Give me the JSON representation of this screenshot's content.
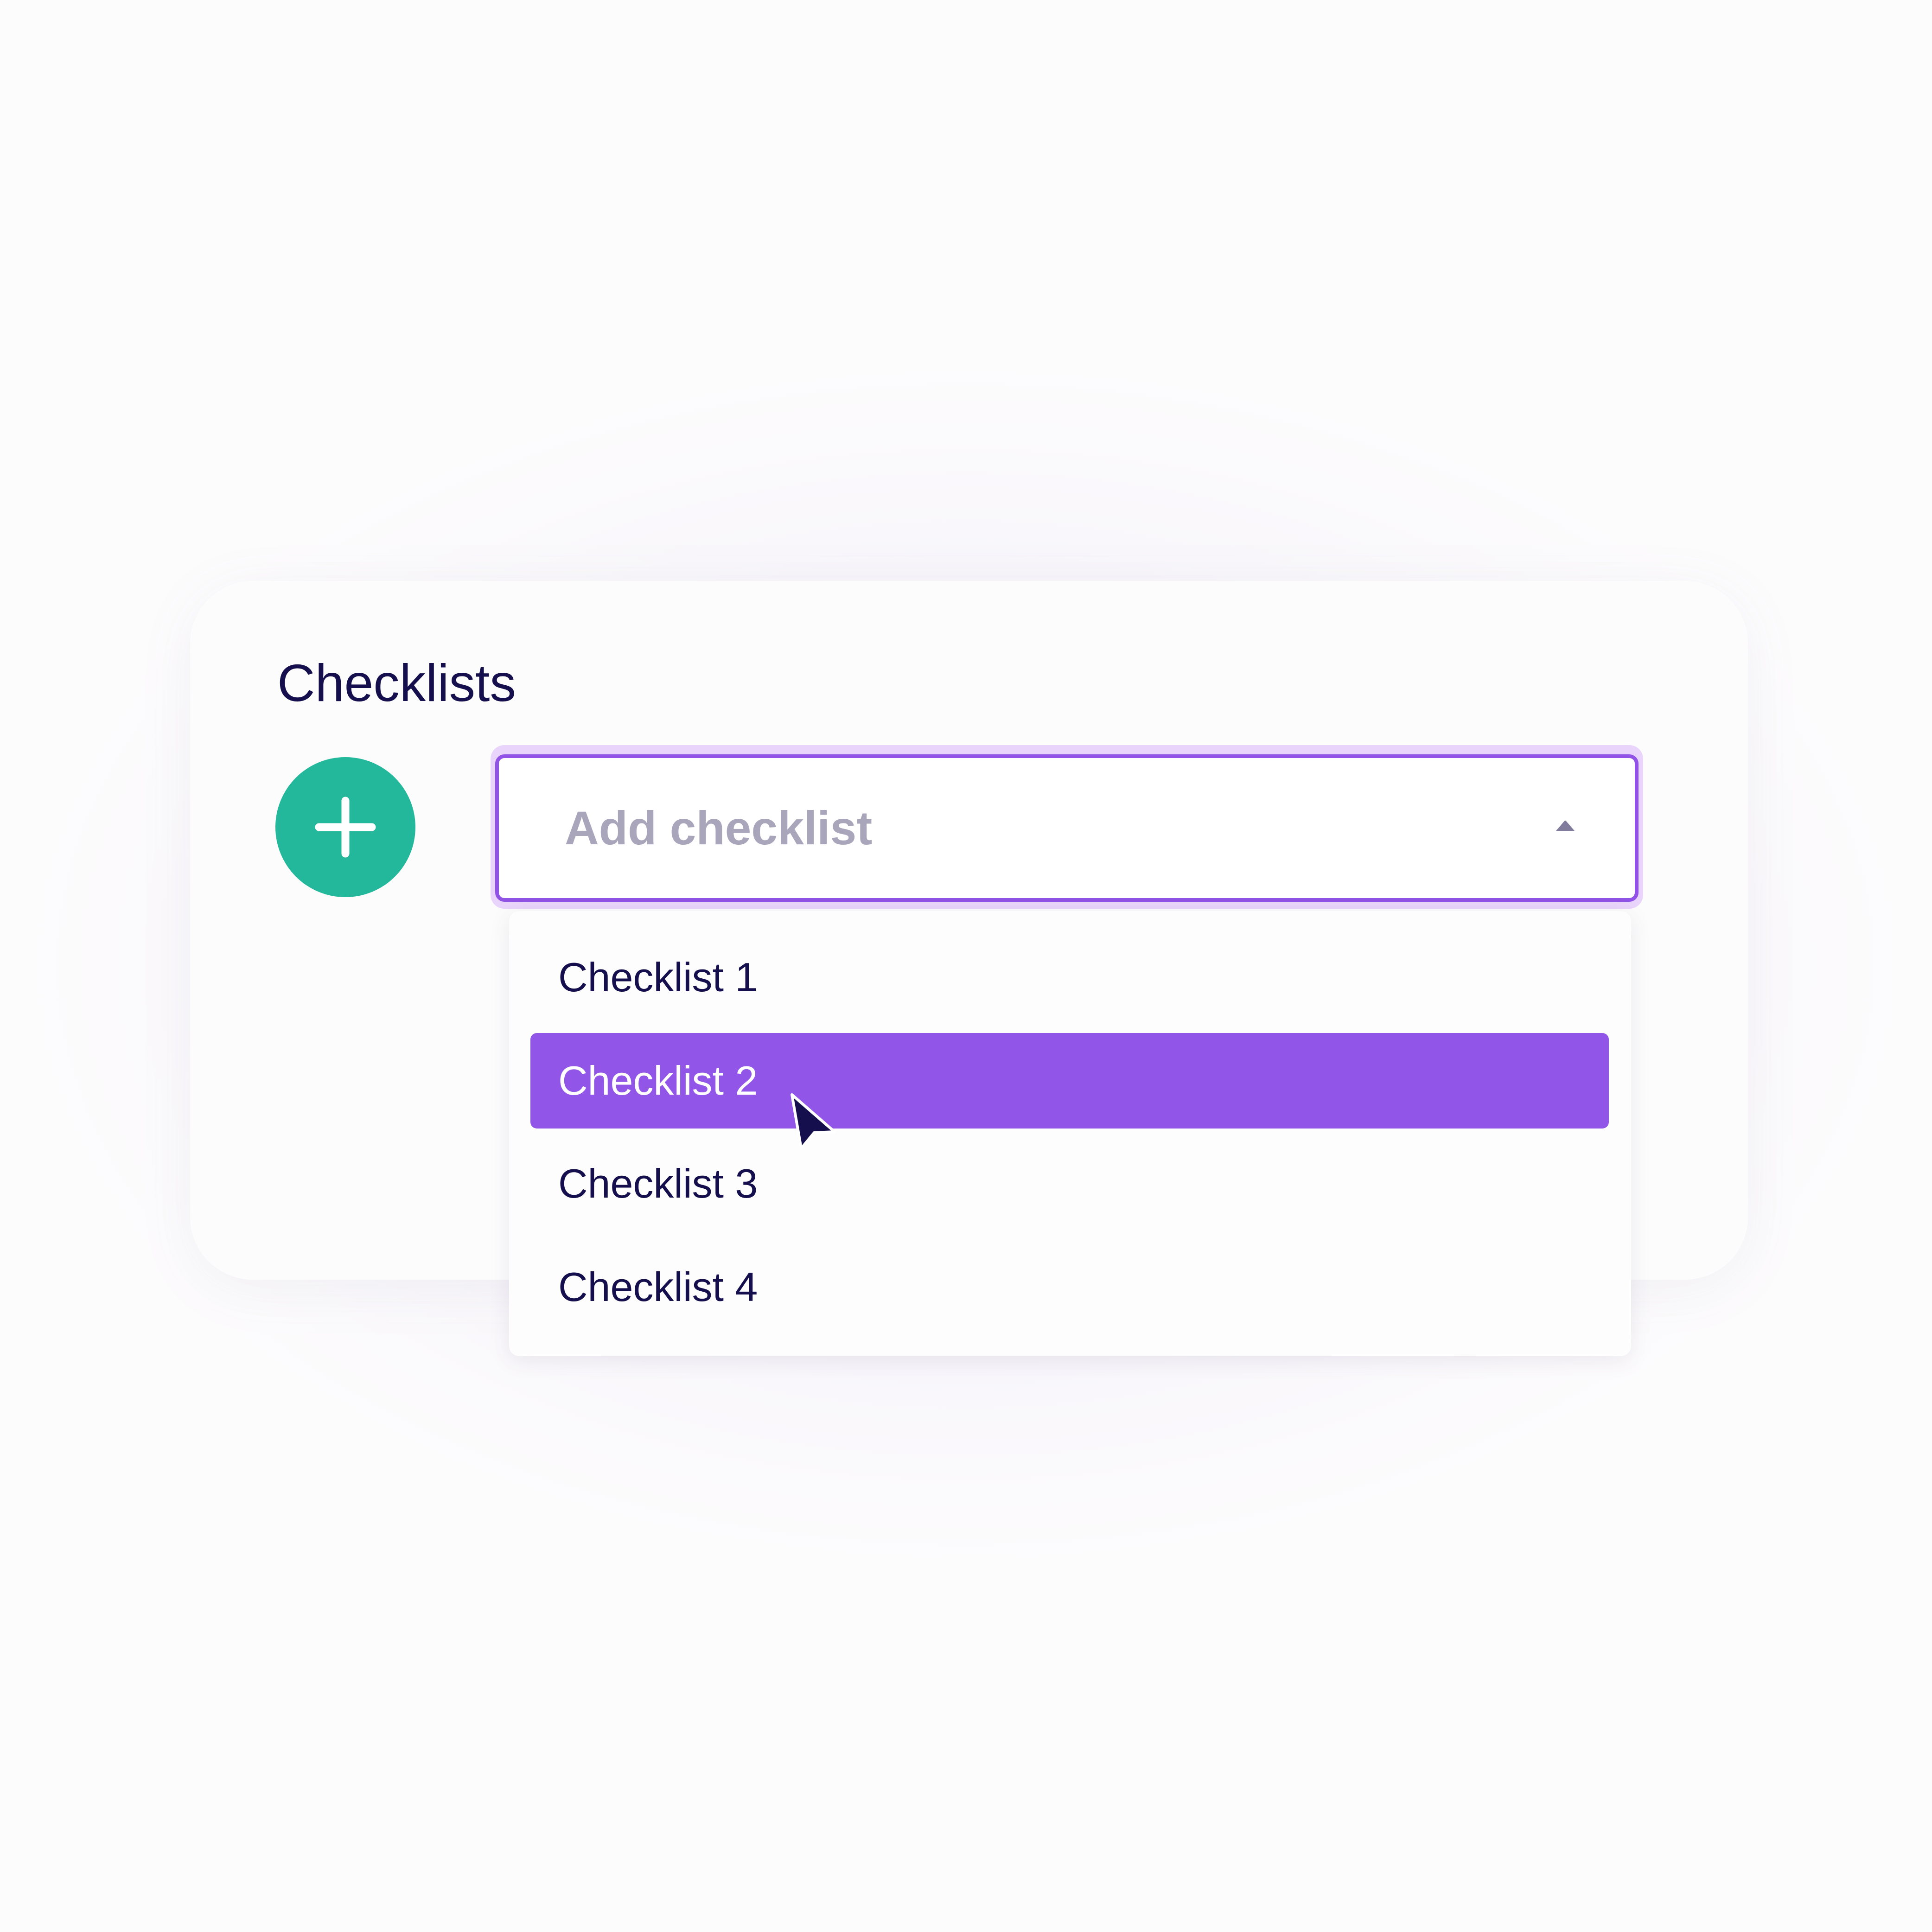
{
  "panel": {
    "title": "Checklists"
  },
  "add_button": {
    "icon": "plus-icon",
    "color": "#23b89b"
  },
  "select": {
    "placeholder": "Add checklist",
    "state": "open",
    "caret_icon": "caret-up-icon",
    "border_color": "#9153e6",
    "focus_ring_color": "#e9d5fb"
  },
  "dropdown": {
    "items": [
      {
        "label": "Checklist 1",
        "selected": false
      },
      {
        "label": "Checklist 2",
        "selected": true
      },
      {
        "label": "Checklist 3",
        "selected": false
      },
      {
        "label": "Checklist 4",
        "selected": false
      }
    ],
    "highlight_color": "#9155e8"
  },
  "pointer": {
    "icon": "mouse-cursor-icon",
    "hovering": "Checklist 2"
  },
  "colors": {
    "text_primary": "#15104d",
    "placeholder": "#a9a5bb",
    "background": "#fdfcfd",
    "card": "#fcfcfc"
  }
}
